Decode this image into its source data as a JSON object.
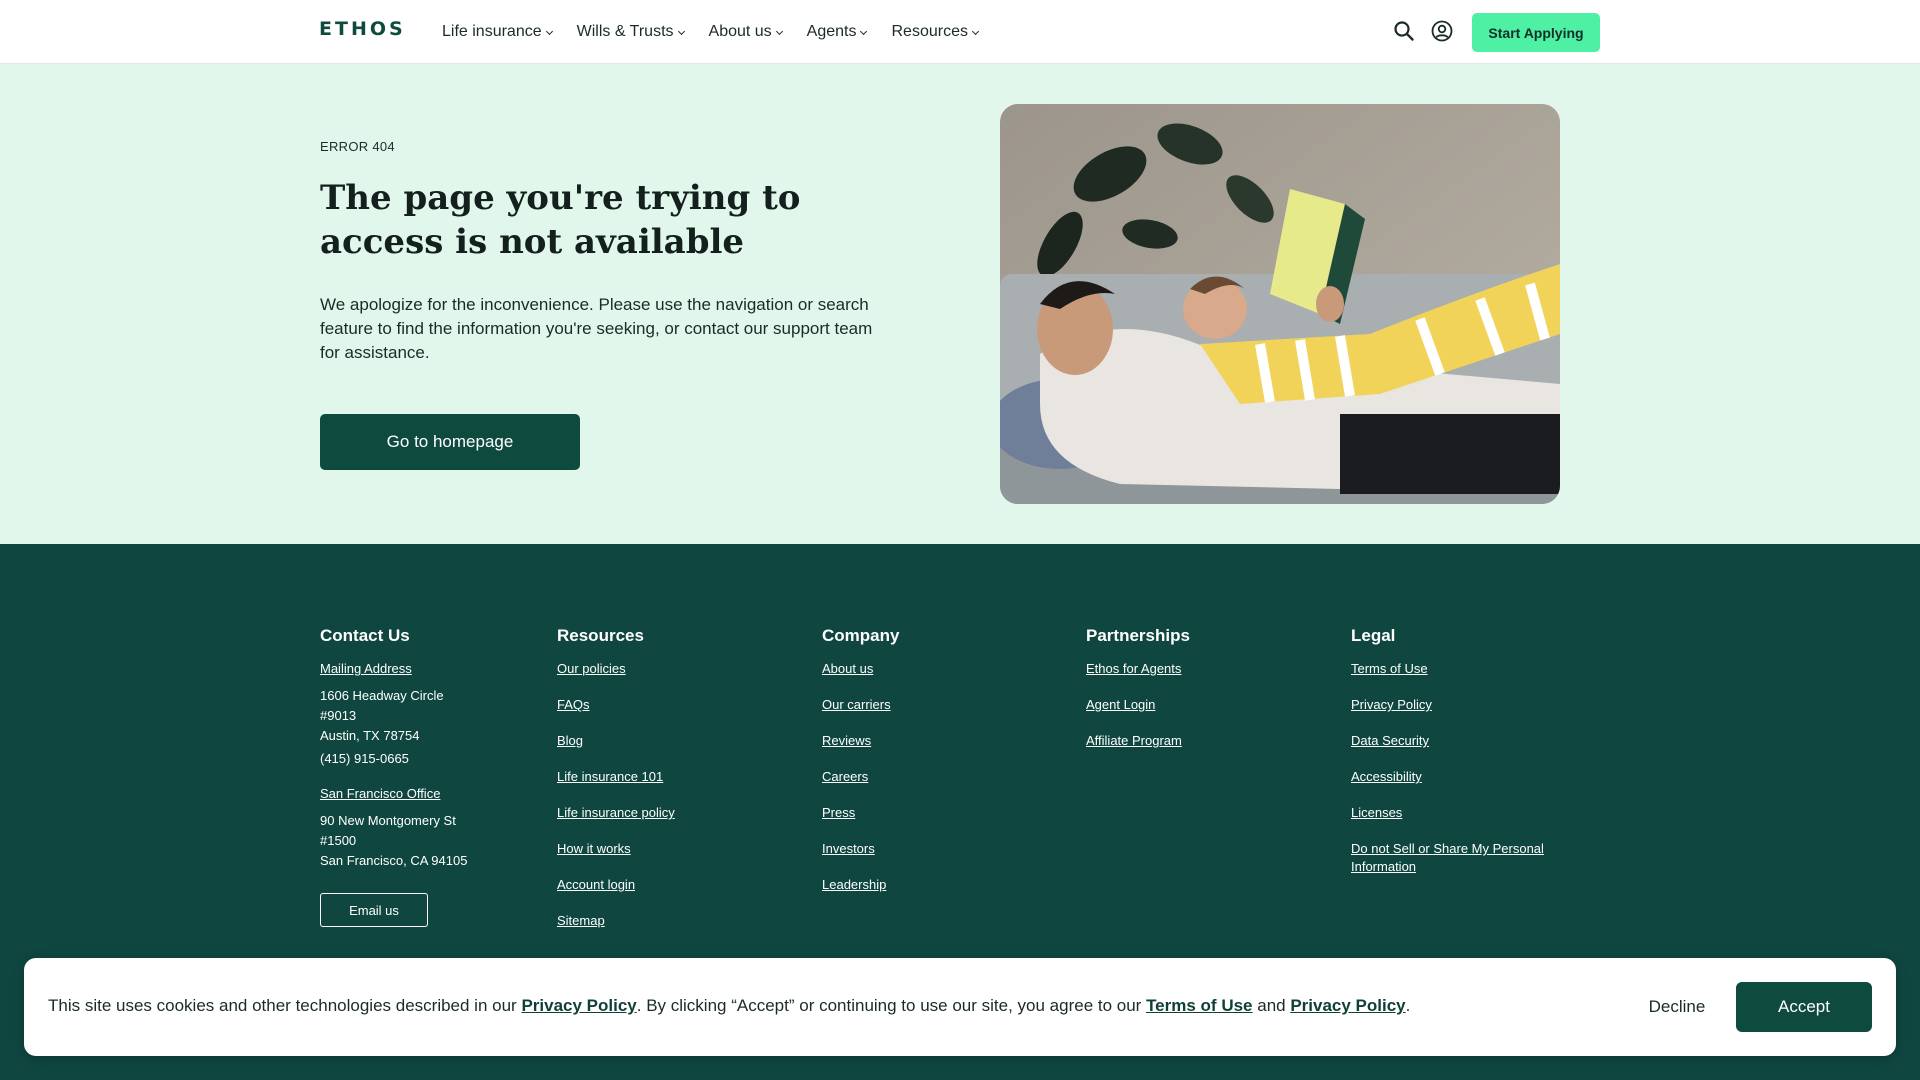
{
  "header": {
    "logo": "ETHOS",
    "nav": [
      {
        "label": "Life insurance"
      },
      {
        "label": "Wills & Trusts"
      },
      {
        "label": "About us"
      },
      {
        "label": "Agents"
      },
      {
        "label": "Resources"
      }
    ],
    "icons": [
      "search-icon",
      "account-icon"
    ],
    "cta_label": "Start Applying"
  },
  "hero": {
    "error_code": "ERROR 404",
    "headline": "The page you're trying to access is not available",
    "description": "We apologize for the inconvenience. Please use the navigation or search feature to find the information you're seeking, or contact our support team for assistance.",
    "button_label": "Go to homepage"
  },
  "footer": {
    "contact": {
      "heading": "Contact Us",
      "mailing_label": "Mailing Address",
      "mailing_line1": "1606 Headway Circle",
      "mailing_line2": "#9013",
      "mailing_line3": "Austin, TX 78754",
      "phone": "(415) 915-0665",
      "sf_label": "San Francisco Office",
      "sf_line1": "90 New Montgomery St",
      "sf_line2": "#1500",
      "sf_line3": "San Francisco, CA 94105",
      "email_button": "Email us"
    },
    "resources": {
      "heading": "Resources",
      "links": [
        "Our policies",
        "FAQs",
        "Blog",
        "Life insurance 101",
        "Life insurance policy",
        "How it works",
        "Account login",
        "Sitemap"
      ]
    },
    "company": {
      "heading": "Company",
      "links": [
        "About us",
        "Our carriers",
        "Reviews",
        "Careers",
        "Press",
        "Investors",
        "Leadership"
      ]
    },
    "partnerships": {
      "heading": "Partnerships",
      "links": [
        "Ethos for Agents",
        "Agent Login",
        "Affiliate Program"
      ]
    },
    "legal": {
      "heading": "Legal",
      "links": [
        "Terms of Use",
        "Privacy Policy",
        "Data Security",
        "Accessibility",
        "Licenses",
        "Do not Sell or Share My Personal Information"
      ]
    }
  },
  "cookie": {
    "text_1": "This site uses cookies and other technologies described in our ",
    "link_privacy_1": "Privacy Policy",
    "text_2": ". By clicking “Accept” or continuing to use our site, you agree to our ",
    "link_terms": "Terms of Use",
    "text_3": " and ",
    "link_privacy_2": "Privacy Policy",
    "text_4": ".",
    "decline_label": "Decline",
    "accept_label": "Accept"
  },
  "colors": {
    "brand_dark": "#0f4a3f",
    "brand_accent": "#4ef0a4",
    "hero_bg": "#e2f7ec",
    "footer_bg": "#0f4740"
  }
}
